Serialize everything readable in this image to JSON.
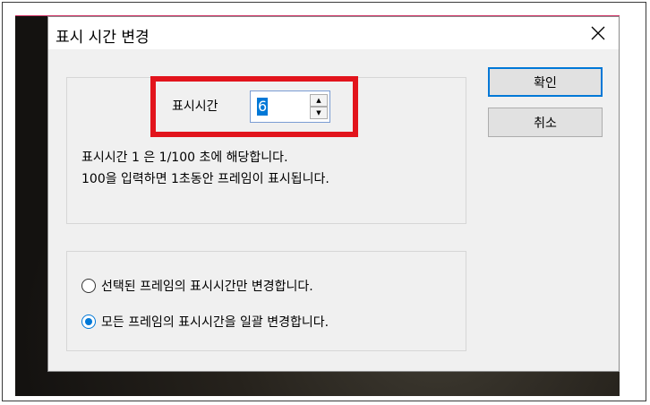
{
  "dialog": {
    "title": "표시 시간 변경",
    "close_icon": "close-icon"
  },
  "display_time": {
    "label": "표시시간",
    "value": "6",
    "spin_up_icon": "triangle-up-icon",
    "spin_down_icon": "triangle-down-icon"
  },
  "info": {
    "line1": "표시시간 1 은 1/100 초에 해당합니다.",
    "line2": "100을 입력하면 1초동안 프레임이 표시됩니다."
  },
  "scope": {
    "options": [
      {
        "label": "선택된 프레임의 표시시간만 변경합니다.",
        "selected": false
      },
      {
        "label": "모든 프레임의 표시시간을 일괄 변경합니다.",
        "selected": true
      }
    ]
  },
  "buttons": {
    "ok_label": "확인",
    "cancel_label": "취소"
  },
  "colors": {
    "highlight": "#e2141c",
    "accent": "#0078d7"
  }
}
